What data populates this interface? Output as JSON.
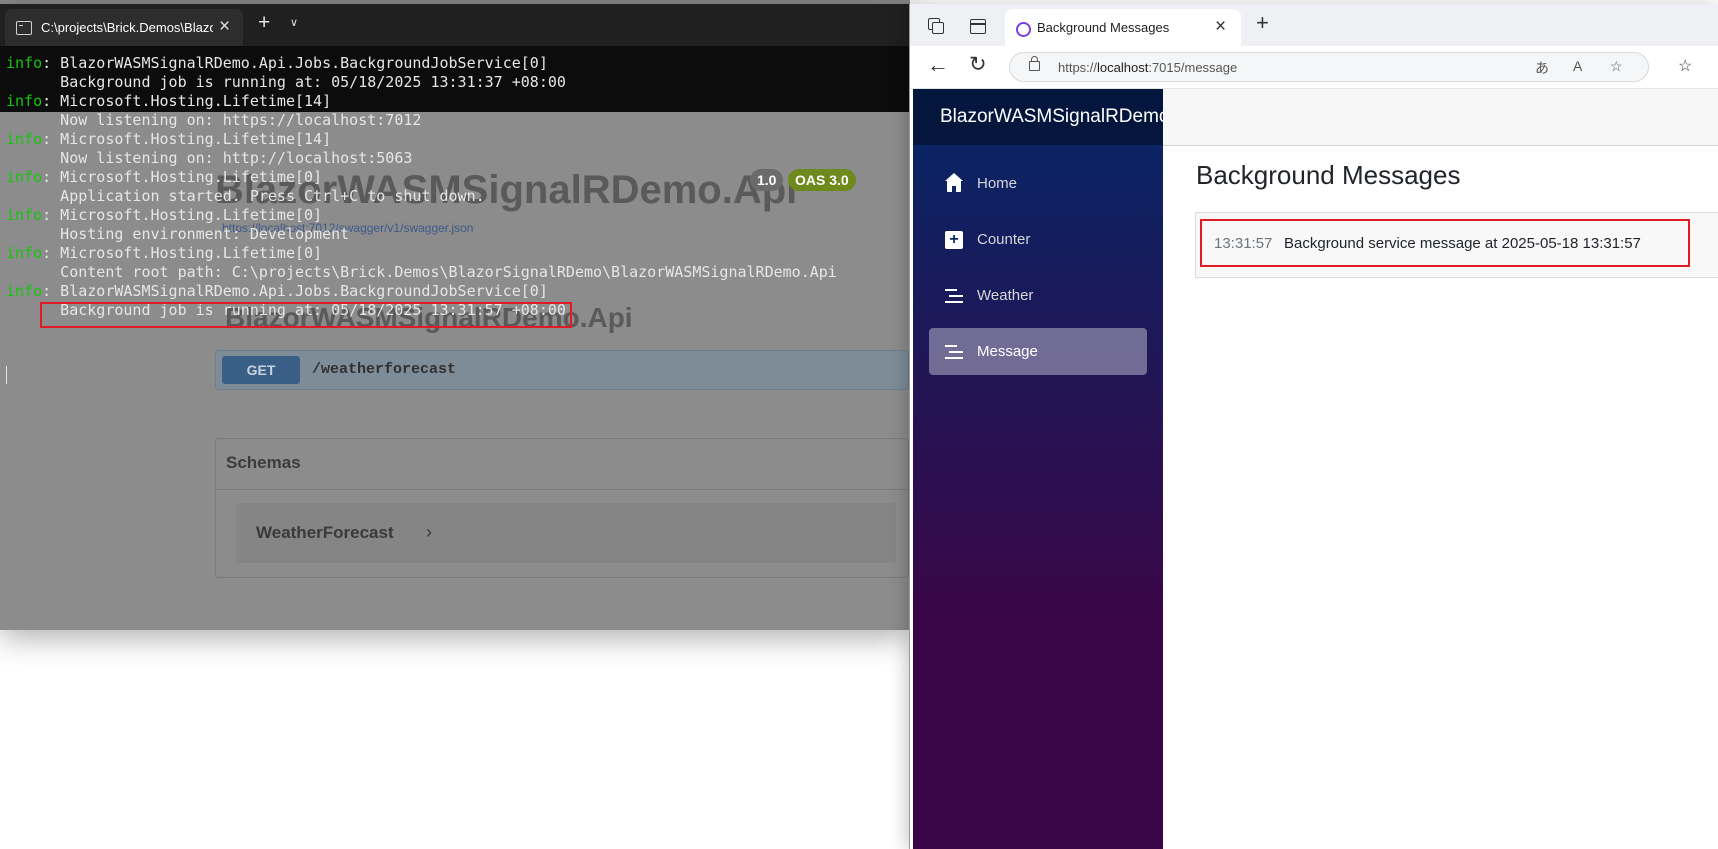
{
  "swagger": {
    "title": "BlazorWASMSignalRDemo.Api",
    "version_badge": "1.0",
    "oas_badge": "OAS 3.0",
    "spec_link": "https://localhost:7012/swagger/v1/swagger.json",
    "section_title": "BlazorWASMSignalRDemo.Api",
    "get_method": "GET",
    "get_path": "/weatherforecast",
    "schemas_title": "Schemas",
    "schema_model": "WeatherForecast",
    "schema_chevron": "›"
  },
  "terminal": {
    "tab_title": "C:\\projects\\Brick.Demos\\Blazor",
    "lines": [
      {
        "prefix": "info",
        "text": ": BlazorWASMSignalRDemo.Api.Jobs.BackgroundJobService[0]"
      },
      {
        "prefix": "",
        "text": "      Background job is running at: 05/18/2025 13:31:37 +08:00"
      },
      {
        "prefix": "info",
        "text": ": Microsoft.Hosting.Lifetime[14]"
      },
      {
        "prefix": "",
        "text": "      Now listening on: https://localhost:7012"
      },
      {
        "prefix": "info",
        "text": ": Microsoft.Hosting.Lifetime[14]"
      },
      {
        "prefix": "",
        "text": "      Now listening on: http://localhost:5063"
      },
      {
        "prefix": "info",
        "text": ": Microsoft.Hosting.Lifetime[0]"
      },
      {
        "prefix": "",
        "text": "      Application started. Press Ctrl+C to shut down."
      },
      {
        "prefix": "info",
        "text": ": Microsoft.Hosting.Lifetime[0]"
      },
      {
        "prefix": "",
        "text": "      Hosting environment: Development"
      },
      {
        "prefix": "info",
        "text": ": Microsoft.Hosting.Lifetime[0]"
      },
      {
        "prefix": "",
        "text": "      Content root path: C:\\projects\\Brick.Demos\\BlazorSignalRDemo\\BlazorWASMSignalRDemo.Api"
      },
      {
        "prefix": "info",
        "text": ": BlazorWASMSignalRDemo.Api.Jobs.BackgroundJobService[0]"
      },
      {
        "prefix": "",
        "text": "      Background job is running at: 05/18/2025 13:31:57 +08:00"
      }
    ]
  },
  "browser": {
    "tab_title": "Background Messages",
    "url_prefix": "https://",
    "url_host": "localhost",
    "url_rest": ":7015/message"
  },
  "app": {
    "brand": "BlazorWASMSignalRDemo.App",
    "nav": [
      {
        "label": "Home",
        "icon": "home-icon",
        "active": false
      },
      {
        "label": "Counter",
        "icon": "plus-icon",
        "active": false
      },
      {
        "label": "Weather",
        "icon": "list-icon",
        "active": false
      },
      {
        "label": "Message",
        "icon": "list-icon",
        "active": true
      }
    ],
    "page_title": "Background Messages",
    "messages": [
      {
        "time": "13:31:57",
        "text": "Background service message at 2025-05-18 13:31:57"
      }
    ]
  },
  "colors": {
    "highlight": "#e01b24",
    "terminal_info": "#16c60c",
    "sidebar_top": "#052767",
    "sidebar_bottom": "#3a0647"
  }
}
